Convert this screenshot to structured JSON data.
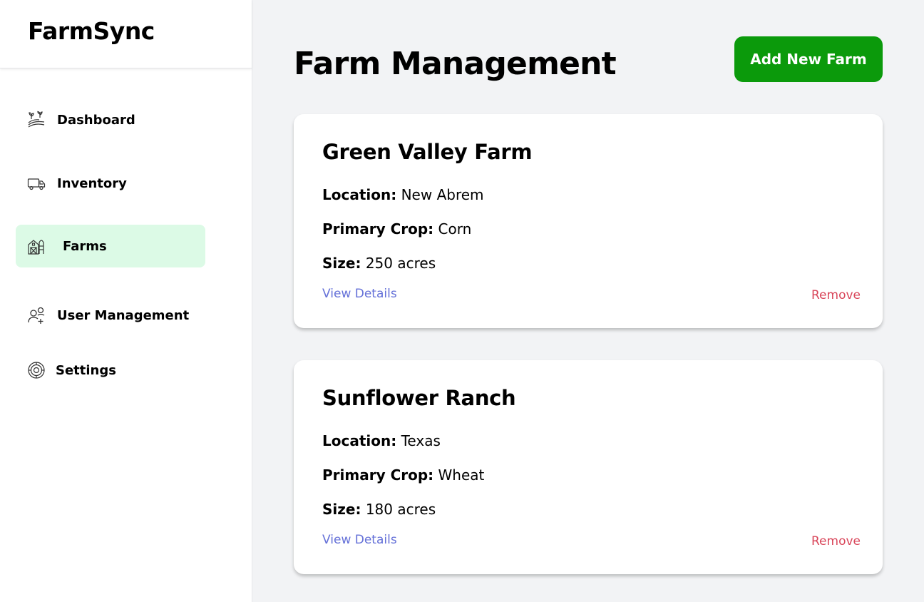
{
  "app": {
    "brand": "FarmSync"
  },
  "sidebar": {
    "items": [
      {
        "label": "Dashboard",
        "icon": "farm-field-icon"
      },
      {
        "label": "Inventory",
        "icon": "truck-icon"
      },
      {
        "label": "Farms",
        "icon": "barn-icon",
        "active": true
      },
      {
        "label": "User Management",
        "icon": "add-user-icon"
      },
      {
        "label": "Settings",
        "icon": "gear-icon"
      }
    ]
  },
  "main": {
    "title": "Farm Management",
    "add_button": "Add New Farm",
    "labels": {
      "location": "Location:",
      "crop": "Primary Crop:",
      "size": "Size:",
      "view": "View Details",
      "remove": "Remove"
    },
    "farms": [
      {
        "name": "Green Valley Farm",
        "location": "New Abrem",
        "crop": "Corn",
        "size": "250 acres"
      },
      {
        "name": "Sunflower Ranch",
        "location": "Texas",
        "crop": "Wheat",
        "size": "180 acres"
      }
    ]
  },
  "colors": {
    "accent": "#0b9a0b",
    "active_nav_bg": "#dcfae6",
    "link": "#6571d8",
    "danger": "#d9465a",
    "background": "#f2f3f5"
  }
}
